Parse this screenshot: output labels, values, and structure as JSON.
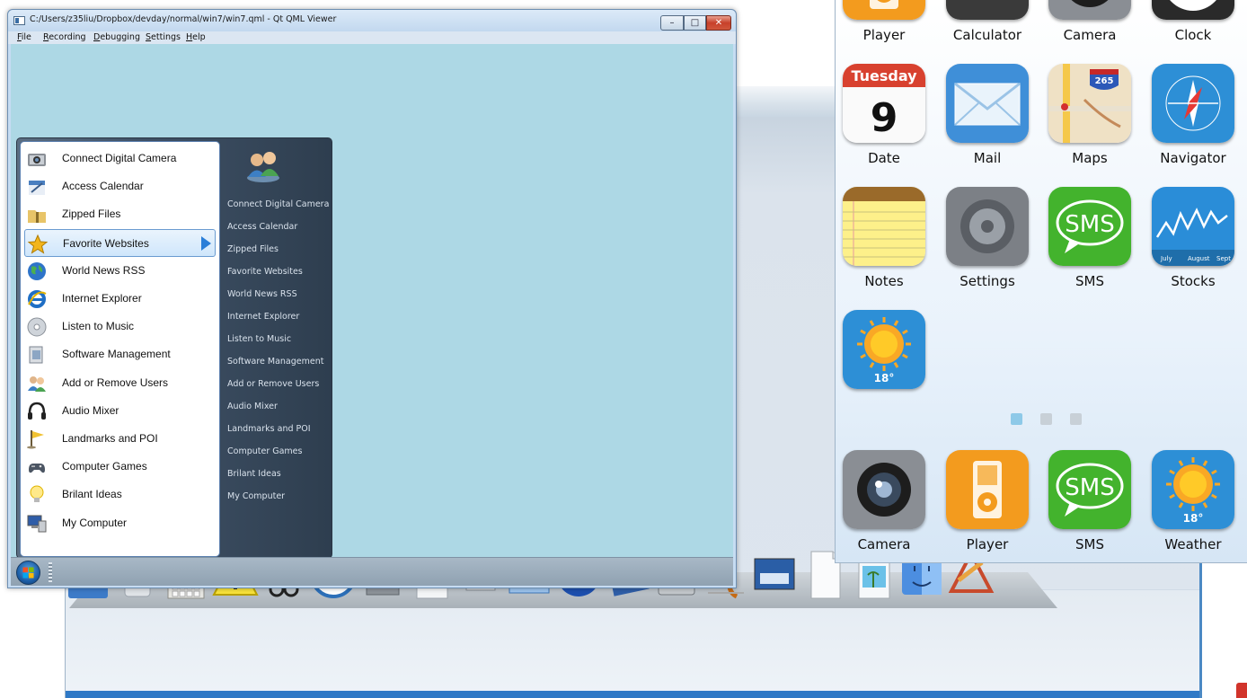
{
  "qt_window": {
    "title": "C:/Users/z35liu/Dropbox/devday/normal/win7/win7.qml - Qt QML Viewer",
    "menu": [
      {
        "first": "F",
        "rest": "ile"
      },
      {
        "first": "R",
        "rest": "ecording"
      },
      {
        "first": "D",
        "rest": "ebugging"
      },
      {
        "first": "S",
        "rest": "ettings"
      },
      {
        "first": "H",
        "rest": "elp"
      }
    ],
    "buttons": {
      "minimize": "–",
      "maximize": "□",
      "close": "✕"
    }
  },
  "start_menu": {
    "items": [
      {
        "label": "Connect Digital Camera",
        "icon": "camera-icon"
      },
      {
        "label": "Access Calendar",
        "icon": "calendar-icon"
      },
      {
        "label": "Zipped Files",
        "icon": "zip-folder-icon"
      },
      {
        "label": "Favorite Websites",
        "icon": "star-icon"
      },
      {
        "label": "World News RSS",
        "icon": "globe-icon"
      },
      {
        "label": "Internet Explorer",
        "icon": "ie-icon"
      },
      {
        "label": "Listen to Music",
        "icon": "cd-icon"
      },
      {
        "label": "Software Management",
        "icon": "software-icon"
      },
      {
        "label": "Add or Remove Users",
        "icon": "users-icon"
      },
      {
        "label": "Audio Mixer",
        "icon": "headphones-icon"
      },
      {
        "label": "Landmarks and POI",
        "icon": "flag-icon"
      },
      {
        "label": "Computer Games",
        "icon": "gamepad-icon"
      },
      {
        "label": "Brilant Ideas",
        "icon": "lightbulb-icon"
      },
      {
        "label": "My Computer",
        "icon": "computer-icon"
      }
    ],
    "selected_index": 3,
    "right_items": [
      "Connect Digital Camera",
      "Access Calendar",
      "Zipped Files",
      "Favorite Websites",
      "World News RSS",
      "Internet Explorer",
      "Listen to Music",
      "Software Management",
      "Add or Remove Users",
      "Audio Mixer",
      "Landmarks and POI",
      "Computer Games",
      "Brilant Ideas",
      "My Computer"
    ]
  },
  "iphone": {
    "rows": [
      [
        {
          "label": "Player",
          "icon": "player-icon"
        },
        {
          "label": "Calculator",
          "icon": "calculator-icon"
        },
        {
          "label": "Camera",
          "icon": "camera-icon"
        },
        {
          "label": "Clock",
          "icon": "clock-icon"
        }
      ],
      [
        {
          "label": "Date",
          "icon": "date-icon"
        },
        {
          "label": "Mail",
          "icon": "mail-icon"
        },
        {
          "label": "Maps",
          "icon": "maps-icon"
        },
        {
          "label": "Navigator",
          "icon": "compass-icon"
        }
      ],
      [
        {
          "label": "Notes",
          "icon": "notes-icon"
        },
        {
          "label": "Settings",
          "icon": "settings-icon"
        },
        {
          "label": "SMS",
          "icon": "sms-icon"
        },
        {
          "label": "Stocks",
          "icon": "stocks-icon"
        }
      ],
      [
        {
          "label": "",
          "icon": "weather-icon"
        }
      ]
    ],
    "date_icon": {
      "day": "Tuesday",
      "number": "9"
    },
    "maps_icon": {
      "shield": "265"
    },
    "sms_text": "SMS",
    "weather_temp": "18°",
    "stocks_months": [
      "July",
      "August",
      "Sept"
    ],
    "page_indicator": {
      "pages": 3,
      "current": 0
    },
    "dock": [
      {
        "label": "Camera",
        "icon": "camera-icon"
      },
      {
        "label": "Player",
        "icon": "player-icon"
      },
      {
        "label": "SMS",
        "icon": "sms-icon"
      },
      {
        "label": "Weather",
        "icon": "weather-icon"
      }
    ]
  },
  "mac_dock": {
    "icons": [
      "address-book-icon",
      "trash-can-icon",
      "calculator-icon",
      "warning-icon",
      "scissors-icon",
      "clock-icon",
      "drive-icon",
      "document-globe-icon",
      "eject-icon",
      "folder-icon",
      "globe-icon",
      "blueprint-icon",
      "hard-disk-icon",
      "script-icon",
      "screen-photo-icon",
      "blank-document-icon",
      "image-file-icon",
      "finder-icon",
      "applications-icon"
    ]
  },
  "colors": {
    "qt_client": "#add8e5",
    "menu_selected_arrow": "#2a7ed8",
    "dock_accent": "#2f79c6"
  }
}
